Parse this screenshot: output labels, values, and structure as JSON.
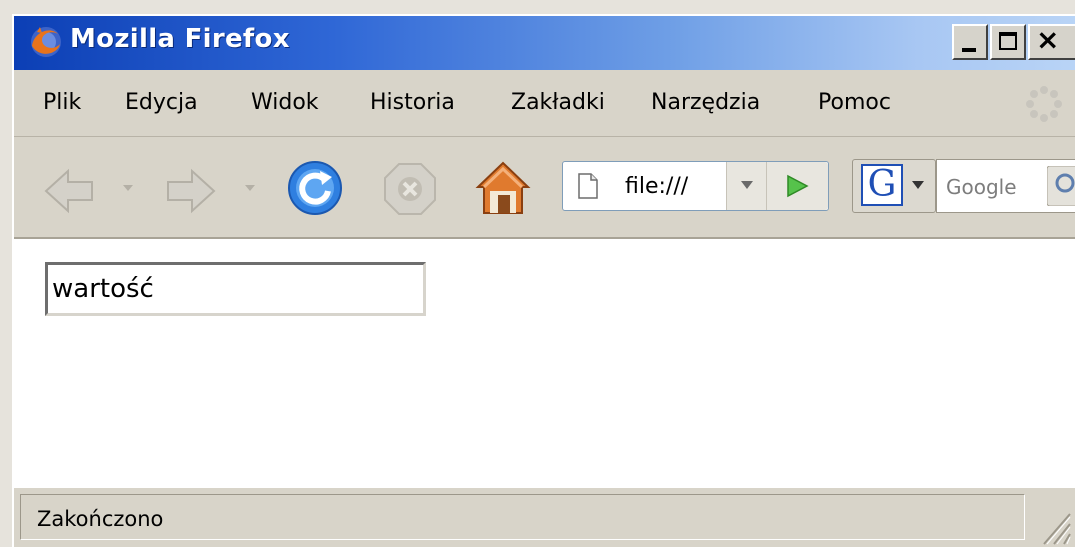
{
  "window": {
    "title": "Mozilla Firefox"
  },
  "menu": {
    "items": [
      {
        "label": "Plik"
      },
      {
        "label": "Edycja"
      },
      {
        "label": "Widok"
      },
      {
        "label": "Historia"
      },
      {
        "label": "Zakładki"
      },
      {
        "label": "Narzędzia"
      },
      {
        "label": "Pomoc"
      }
    ]
  },
  "navigation": {
    "address": "file:///",
    "search_engine_icon": "google-g-icon",
    "search_placeholder": "Google"
  },
  "content": {
    "input_value": "wartość"
  },
  "status": {
    "text": "Zakończono"
  },
  "colors": {
    "titlebar_start": "#0c3fb5",
    "titlebar_end": "#b9d4f6",
    "chrome_bg": "#d8d4c9",
    "reload_blue": "#2f7fe0"
  }
}
